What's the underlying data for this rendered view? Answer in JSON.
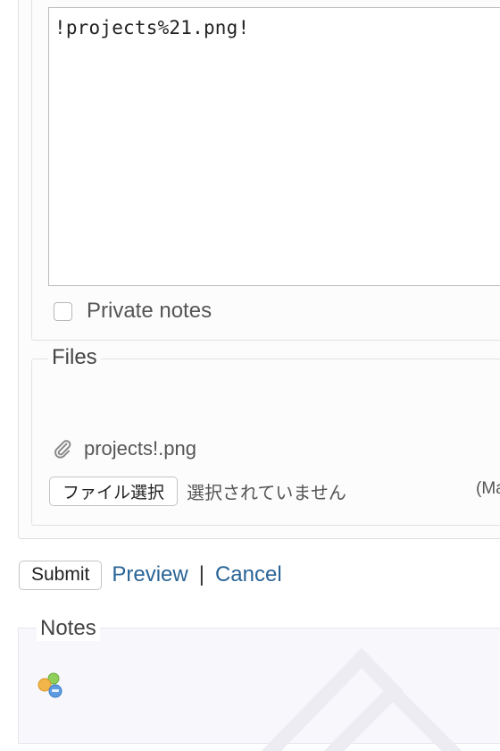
{
  "notes_editor": {
    "content": "!projects%21.png!"
  },
  "private_notes": {
    "label": "Private notes",
    "checked": false
  },
  "files": {
    "legend": "Files",
    "attachment": {
      "icon": "paperclip-icon",
      "filename": "projects!.png"
    },
    "file_input": {
      "button_label": "ファイル選択",
      "status": "選択されていません"
    },
    "max_size_hint": "(Ma"
  },
  "actions": {
    "submit_label": "Submit",
    "preview_label": "Preview",
    "separator": "|",
    "cancel_label": "Cancel"
  },
  "history": {
    "legend": "Notes",
    "icon": "users-group-icon"
  },
  "colors": {
    "link": "#2a6496",
    "history_background": "#f7f7fc",
    "box_border": "#dddddd"
  }
}
